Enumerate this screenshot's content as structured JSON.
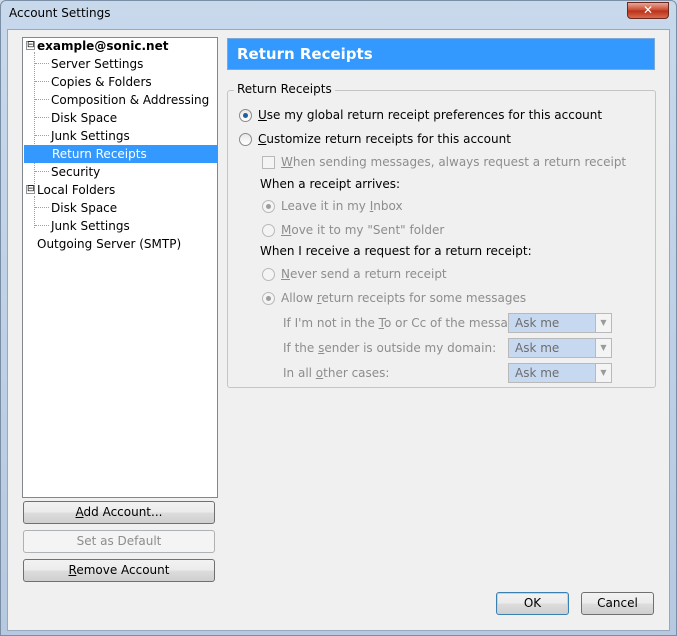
{
  "window": {
    "title": "Account Settings",
    "close_label": "✕"
  },
  "tree": {
    "items": [
      {
        "label": "example@sonic.net",
        "level": 0,
        "expander": "⊟"
      },
      {
        "label": "Server Settings",
        "level": 1
      },
      {
        "label": "Copies & Folders",
        "level": 1
      },
      {
        "label": "Composition & Addressing",
        "level": 1
      },
      {
        "label": "Disk Space",
        "level": 1
      },
      {
        "label": "Junk Settings",
        "level": 1
      },
      {
        "label": "Return Receipts",
        "level": 1,
        "selected": true
      },
      {
        "label": "Security",
        "level": 1
      },
      {
        "label": "Local Folders",
        "level": 0,
        "expander": "⊟"
      },
      {
        "label": "Disk Space",
        "level": 1
      },
      {
        "label": "Junk Settings",
        "level": 1
      },
      {
        "label": "Outgoing Server (SMTP)",
        "level": 0
      }
    ]
  },
  "left_buttons": {
    "add_account": {
      "pre": "",
      "u": "A",
      "post": "dd Account..."
    },
    "set_default": "Set as Default",
    "remove_account": {
      "pre": "",
      "u": "R",
      "post": "emove Account"
    }
  },
  "panel": {
    "header": "Return Receipts",
    "group_legend": "Return Receipts",
    "radio_global": {
      "pre": "",
      "u": "U",
      "post": "se my global return receipt preferences for this account"
    },
    "radio_custom": {
      "pre": "",
      "u": "C",
      "post": "ustomize return receipts for this account"
    },
    "check_always": {
      "pre": "",
      "u": "W",
      "post": "hen sending messages, always request a return receipt"
    },
    "receipt_arrives_label": "When a receipt arrives:",
    "radio_leave_inbox": {
      "pre": "Leave it in my ",
      "u": "I",
      "post": "nbox"
    },
    "radio_move_sent": {
      "pre": "",
      "u": "M",
      "post": "ove it to my \"Sent\" folder"
    },
    "request_label": "When I receive a request for a return receipt:",
    "radio_never": {
      "pre": "",
      "u": "N",
      "post": "ever send a return receipt"
    },
    "radio_allow": {
      "pre": "Allow ",
      "u": "r",
      "post": "eturn receipts for some messages"
    },
    "cond_not_in_to": {
      "pre": "If I'm not in the ",
      "u": "T",
      "post": "o or Cc of the message:"
    },
    "cond_outside_domain": {
      "pre": "If the ",
      "u": "s",
      "post": "ender is outside my domain:"
    },
    "cond_other": {
      "pre": "In all ",
      "u": "o",
      "post": "ther cases:"
    },
    "select_value": "Ask me"
  },
  "dialog_buttons": {
    "ok": "OK",
    "cancel": "Cancel"
  },
  "colors": {
    "selection": "#3399ff",
    "header_bg": "#3399ff"
  }
}
